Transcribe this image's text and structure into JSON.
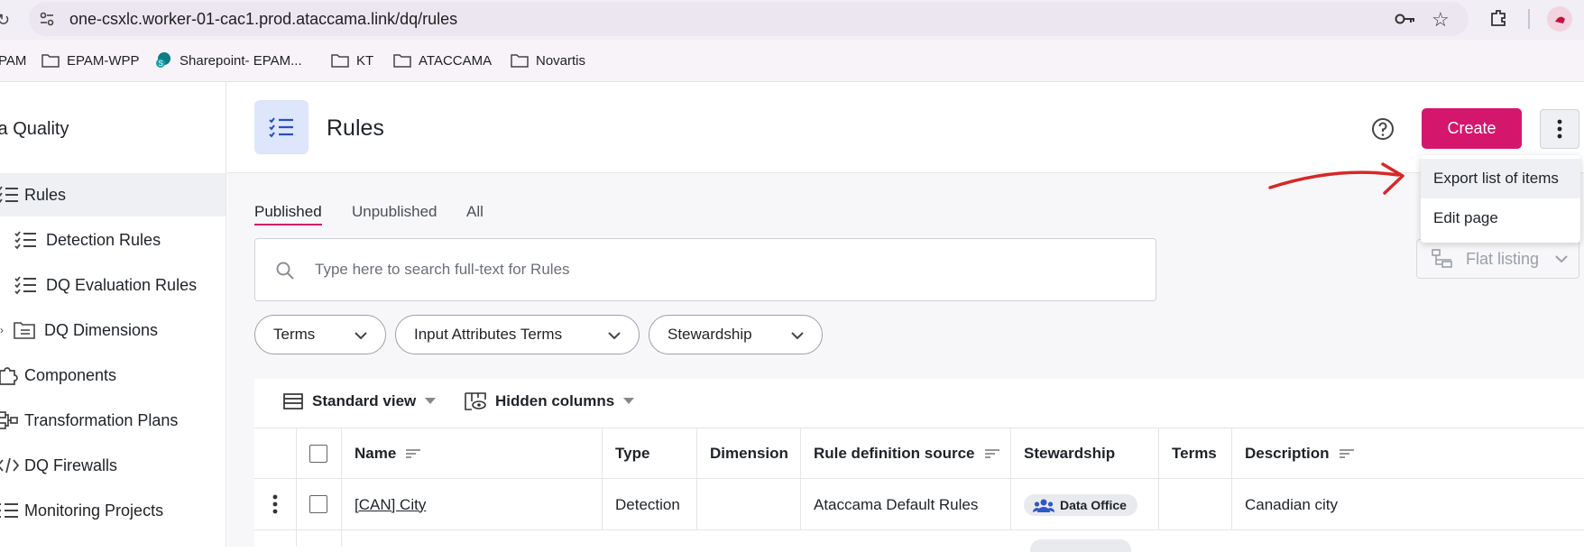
{
  "browser": {
    "url": "one-csxlc.worker-01-cac1.prod.ataccama.link/dq/rules",
    "bookmarks": [
      {
        "label": "PAM",
        "icon": "none"
      },
      {
        "label": "EPAM-WPP",
        "icon": "folder-icon"
      },
      {
        "label": "Sharepoint- EPAM...",
        "icon": "sharepoint-icon"
      },
      {
        "label": "KT",
        "icon": "folder-icon"
      },
      {
        "label": "ATACCAMA",
        "icon": "folder-icon"
      },
      {
        "label": "Novartis",
        "icon": "folder-icon"
      }
    ]
  },
  "sidebar": {
    "title": "ta Quality",
    "items": [
      {
        "label": "Rules",
        "active": true
      },
      {
        "label": "Detection Rules"
      },
      {
        "label": "DQ Evaluation Rules"
      },
      {
        "label": "DQ Dimensions"
      },
      {
        "label": "Components"
      },
      {
        "label": "Transformation Plans"
      },
      {
        "label": "DQ Firewalls"
      },
      {
        "label": "Monitoring Projects"
      }
    ]
  },
  "header": {
    "title": "Rules",
    "create_label": "Create"
  },
  "tabs": [
    {
      "label": "Published",
      "active": true
    },
    {
      "label": "Unpublished"
    },
    {
      "label": "All"
    }
  ],
  "search": {
    "placeholder": "Type here to search full-text for Rules"
  },
  "filters": [
    "Terms",
    "Input Attributes Terms",
    "Stewardship"
  ],
  "listing": {
    "mode_label": "Flat listing"
  },
  "menu": {
    "items": [
      "Export list of items",
      "Edit page"
    ]
  },
  "table": {
    "view_label": "Standard view",
    "hidden_columns_label": "Hidden columns",
    "columns": [
      "Name",
      "Type",
      "Dimension",
      "Rule definition source",
      "Stewardship",
      "Terms",
      "Description"
    ],
    "rows": [
      {
        "name": "[CAN] City",
        "type": "Detection",
        "dimension": "",
        "source": "Ataccama Default Rules",
        "stewardship": "Data Office",
        "terms": "",
        "description": "Canadian city"
      }
    ]
  },
  "colors": {
    "accent": "#d4176d",
    "page_icon_bg": "#dde6fb",
    "annotation": "#d62828"
  }
}
